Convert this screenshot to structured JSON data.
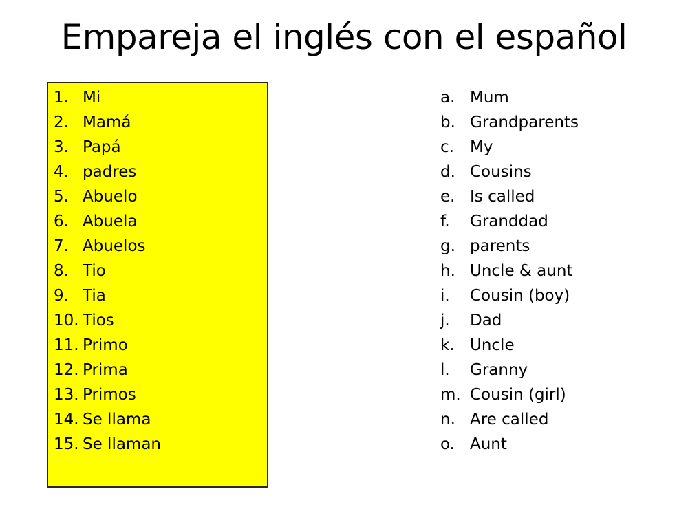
{
  "slide": {
    "title": "Empareja el inglés con el español",
    "background_color": "#FFFFFF",
    "highlight_color": "#FFFF00",
    "text_color": "#000000",
    "border_color": "#2B2A12"
  },
  "spanish_column": {
    "items": [
      {
        "marker": "1.",
        "text": "Mi"
      },
      {
        "marker": "2.",
        "text": "Mamá"
      },
      {
        "marker": "3.",
        "text": "Papá"
      },
      {
        "marker": "4.",
        "text": "padres"
      },
      {
        "marker": "5.",
        "text": "Abuelo"
      },
      {
        "marker": "6.",
        "text": "Abuela"
      },
      {
        "marker": "7.",
        "text": "Abuelos"
      },
      {
        "marker": "8.",
        "text": "Tio"
      },
      {
        "marker": "9.",
        "text": "Tia"
      },
      {
        "marker": "10.",
        "text": "Tios"
      },
      {
        "marker": "11.",
        "text": "Primo"
      },
      {
        "marker": "12.",
        "text": "Prima"
      },
      {
        "marker": "13.",
        "text": "Primos"
      },
      {
        "marker": "14.",
        "text": "Se llama"
      },
      {
        "marker": "15.",
        "text": "Se llaman"
      }
    ]
  },
  "english_column": {
    "items": [
      {
        "marker": "a.",
        "text": "Mum"
      },
      {
        "marker": "b.",
        "text": "Grandparents"
      },
      {
        "marker": "c.",
        "text": "My"
      },
      {
        "marker": "d.",
        "text": "Cousins"
      },
      {
        "marker": "e.",
        "text": "Is called"
      },
      {
        "marker": "f.",
        "text": "Granddad"
      },
      {
        "marker": "g.",
        "text": "parents"
      },
      {
        "marker": "h.",
        "text": "Uncle & aunt"
      },
      {
        "marker": "i.",
        "text": "Cousin (boy)"
      },
      {
        "marker": "j.",
        "text": "Dad"
      },
      {
        "marker": "k.",
        "text": "Uncle"
      },
      {
        "marker": "l.",
        "text": "Granny"
      },
      {
        "marker": "m.",
        "text": "Cousin (girl)"
      },
      {
        "marker": "n.",
        "text": "Are called"
      },
      {
        "marker": "o.",
        "text": "Aunt"
      }
    ]
  }
}
